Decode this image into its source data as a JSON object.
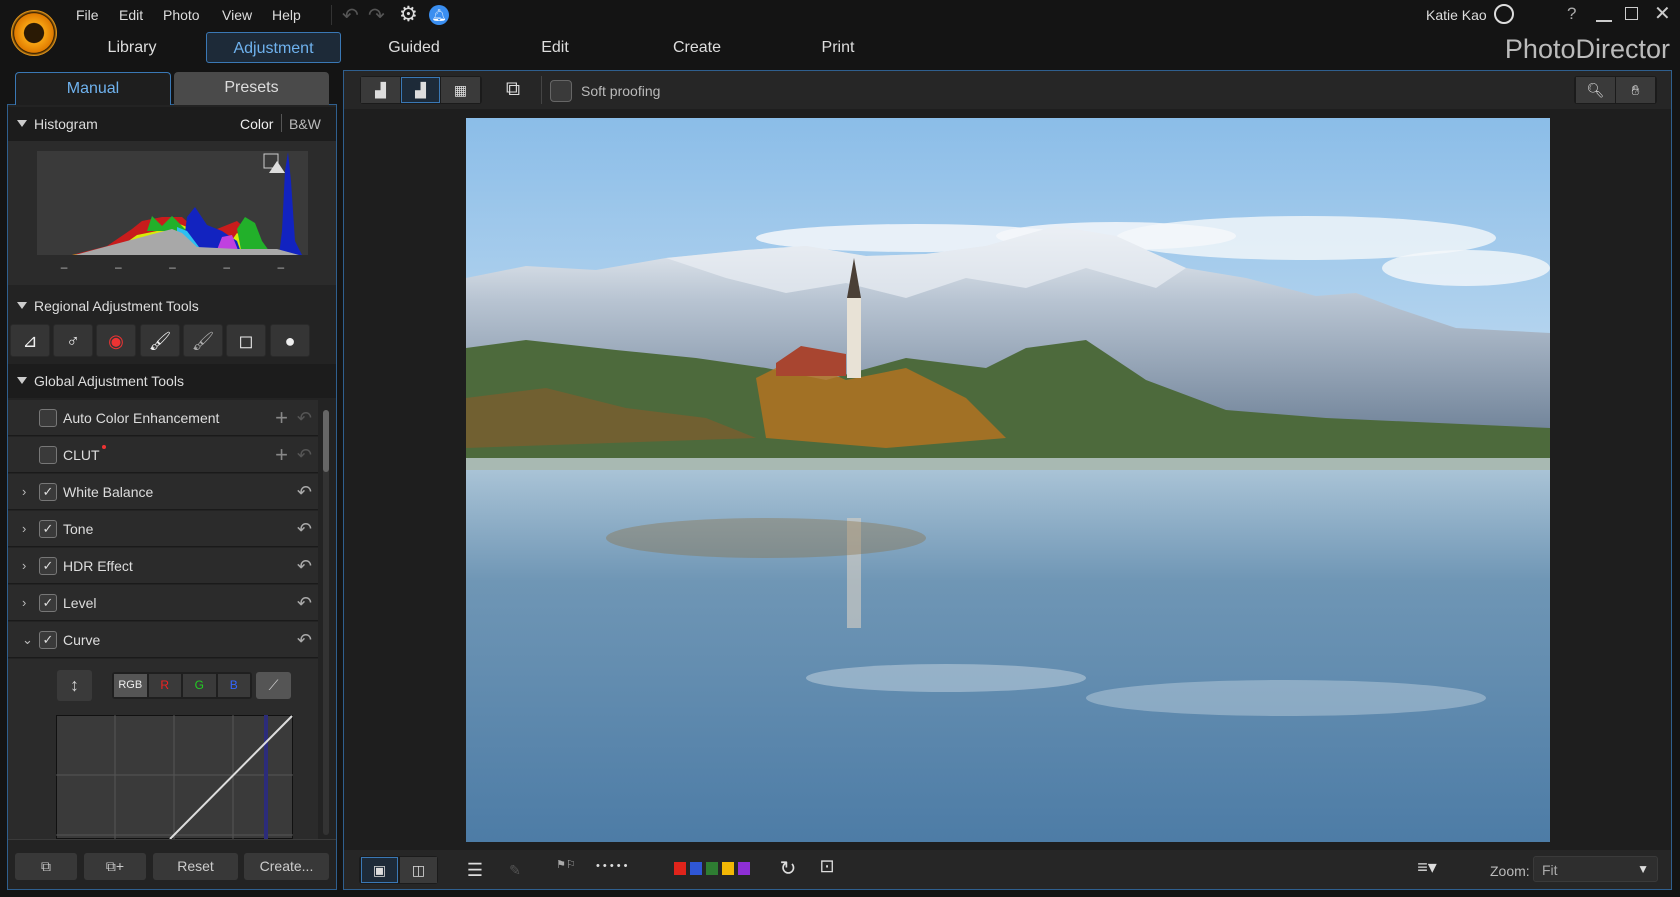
{
  "menu": {
    "file": "File",
    "edit": "Edit",
    "photo": "Photo",
    "view": "View",
    "help": "Help"
  },
  "modules": {
    "library": "Library",
    "adjustment": "Adjustment",
    "guided": "Guided",
    "edit": "Edit",
    "create": "Create",
    "print": "Print"
  },
  "app_title": "PhotoDirector",
  "user": {
    "name": "Katie Kao"
  },
  "window": {
    "help": "?"
  },
  "panel_tabs": {
    "manual": "Manual",
    "presets": "Presets"
  },
  "histogram": {
    "title": "Histogram",
    "color": "Color",
    "bw": "B&W",
    "ticks": [
      "–",
      "–",
      "–",
      "–",
      "–"
    ]
  },
  "regional": {
    "title": "Regional Adjustment Tools"
  },
  "global": {
    "title": "Global Adjustment Tools",
    "items": [
      {
        "label": "Auto Color Enhancement",
        "checked": false
      },
      {
        "label": "CLUT",
        "checked": false
      },
      {
        "label": "White Balance",
        "checked": true
      },
      {
        "label": "Tone",
        "checked": true
      },
      {
        "label": "HDR Effect",
        "checked": true
      },
      {
        "label": "Level",
        "checked": true
      },
      {
        "label": "Curve",
        "checked": true
      }
    ]
  },
  "curve": {
    "rgb": "RGB",
    "r": "R",
    "g": "G",
    "b": "B"
  },
  "bottom_left": {
    "reset": "Reset",
    "create": "Create..."
  },
  "toolbar": {
    "soft_proofing": "Soft proofing"
  },
  "bottom_bar": {
    "dots": "• • • • •",
    "zoom_label": "Zoom:",
    "zoom_value": "Fit",
    "color_labels": [
      "#e0241b",
      "#2f57d6",
      "#2e7d32",
      "#f2b705",
      "#8e2fd6"
    ]
  },
  "colors": {
    "accent": "#3a78b5",
    "accent_text": "#6fb2ee"
  }
}
